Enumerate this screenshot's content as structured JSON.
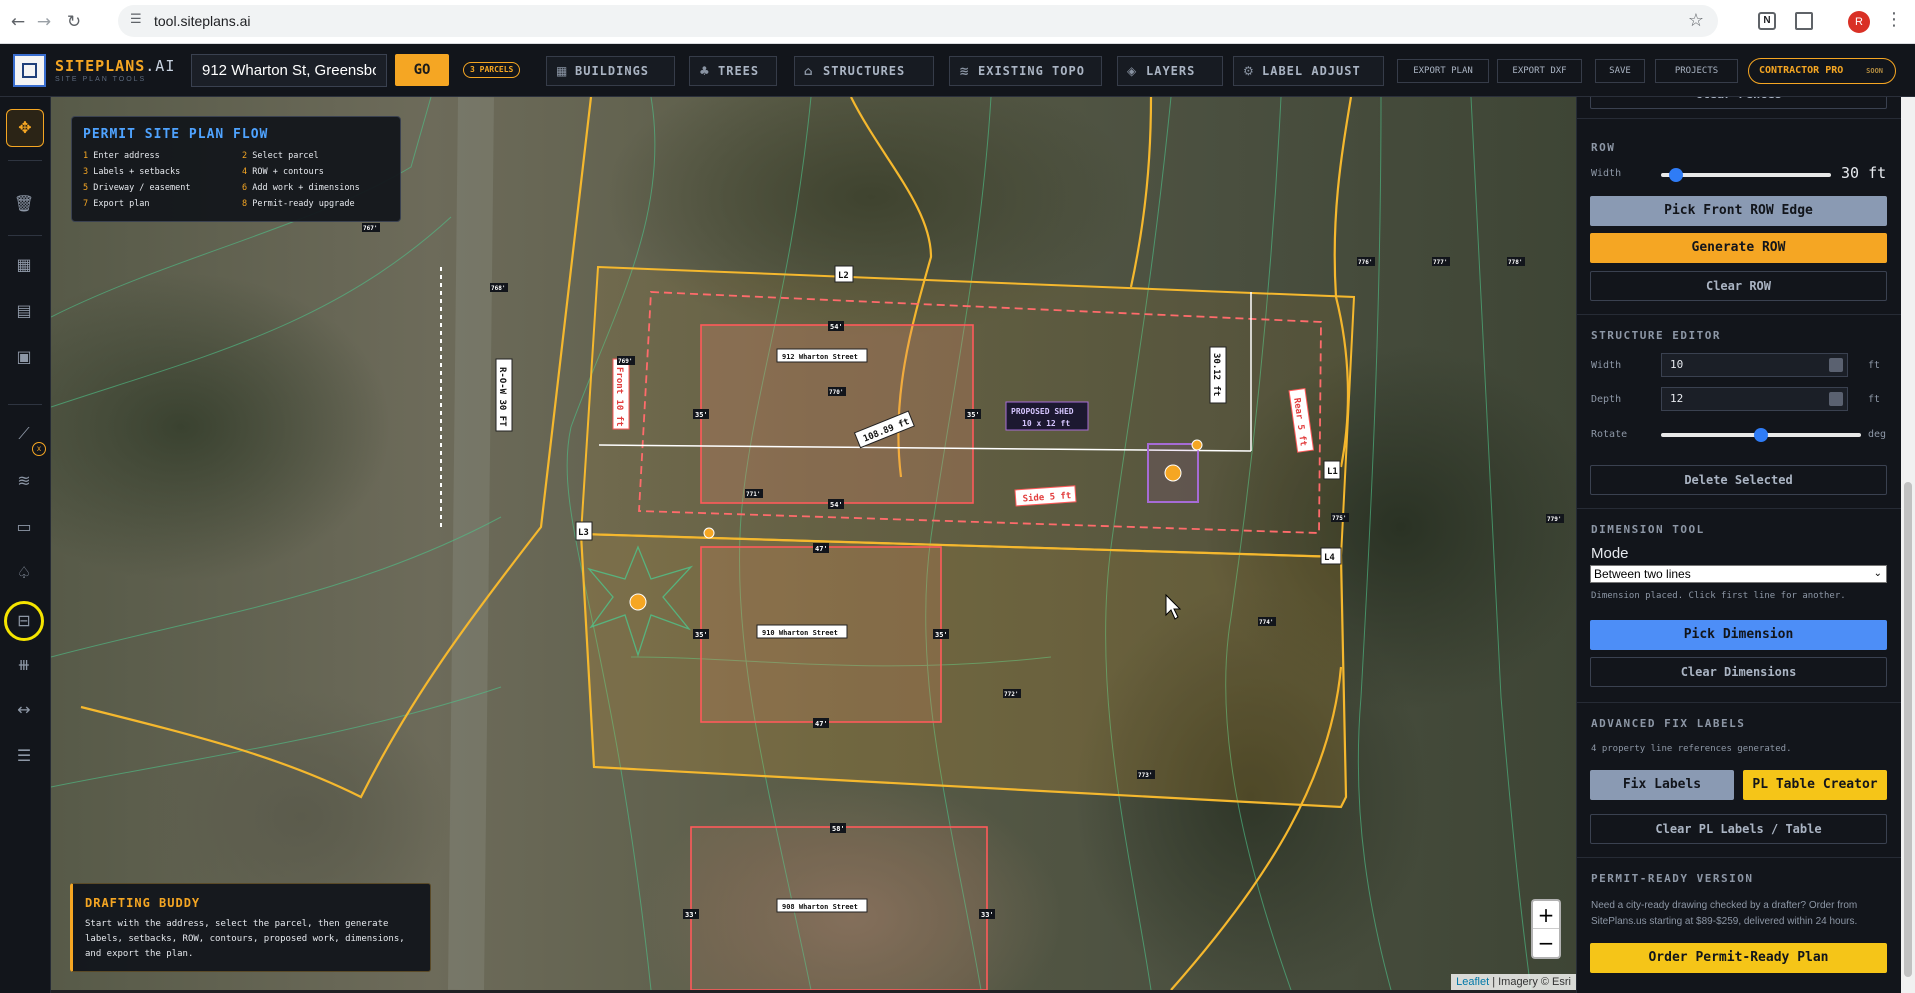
{
  "browser": {
    "url": "tool.siteplans.ai",
    "profile_initial": "R",
    "icons": [
      "back-icon",
      "forward-icon",
      "reload-icon",
      "site-info-icon",
      "bookmark-star-icon",
      "extensions-icon",
      "menu-icon"
    ]
  },
  "header": {
    "brand": "SITEPLANS",
    "brand_suffix": ".AI",
    "tagline": "SITE PLAN TOOLS",
    "address_value": "912 Wharton St, Greensbor",
    "go_label": "GO",
    "parcels_badge": "3 PARCELS",
    "buttons": [
      {
        "label": "BUILDINGS",
        "icon": "grid-icon"
      },
      {
        "label": "TREES",
        "icon": "tree-icon"
      },
      {
        "label": "STRUCTURES",
        "icon": "house-icon"
      },
      {
        "label": "EXISTING TOPO",
        "icon": "topo-icon"
      },
      {
        "label": "LAYERS",
        "icon": "layers-icon"
      },
      {
        "label": "LABEL ADJUST",
        "icon": "gear-icon"
      }
    ],
    "small_buttons": [
      "EXPORT PLAN",
      "EXPORT DXF",
      "SAVE",
      "PROJECTS"
    ],
    "pro_label": "CONTRACTOR PRO",
    "pro_soon": "SOON"
  },
  "toolbar": {
    "tools": [
      "select-tool-icon",
      "trash-icon",
      "grid-icon",
      "list-icon",
      "map-icon",
      "contour-icon",
      "contour-lines-icon",
      "road-icon",
      "tree-icon",
      "dimension-icon",
      "ruler-icon",
      "width-icon",
      "menu-lines-icon"
    ],
    "badge": "x"
  },
  "flow": {
    "title": "PERMIT SITE PLAN FLOW",
    "steps": [
      {
        "n": "1",
        "text": "Enter address"
      },
      {
        "n": "2",
        "text": "Select parcel"
      },
      {
        "n": "3",
        "text": "Labels + setbacks"
      },
      {
        "n": "4",
        "text": "ROW + contours"
      },
      {
        "n": "5",
        "text": "Driveway / easement"
      },
      {
        "n": "6",
        "text": "Add work + dimensions"
      },
      {
        "n": "7",
        "text": "Export plan"
      },
      {
        "n": "8",
        "text": "Permit-ready upgrade"
      }
    ]
  },
  "buddy": {
    "title": "DRAFTING BUDDY",
    "text": "Start with the address, select the parcel, then generate labels, setbacks, ROW, contours, proposed work, dimensions, and export the plan."
  },
  "map": {
    "row_label": "R-O-W 30 FT",
    "front_label": "Front 10 ft",
    "rear_label": "Rear 5 ft",
    "side_label": "Side 5 ft",
    "dim_label": "108.89 ft",
    "dim2_label": "30.12 ft",
    "shed_line1": "PROPOSED SHED",
    "shed_line2": "10 x 12 ft",
    "pl_labels": [
      "L1",
      "L2",
      "L3",
      "L4"
    ],
    "houses": [
      {
        "name": "912 Wharton Street",
        "front": "54'",
        "back": "54'",
        "left": "35'",
        "right": "35'"
      },
      {
        "name": "910 Wharton Street",
        "front": "47'",
        "back": "47'",
        "left": "35'",
        "right": "35'"
      },
      {
        "name": "908 Wharton Street",
        "front": "58'",
        "left": "33'",
        "right": "33'"
      }
    ],
    "contours": [
      "767'",
      "768'",
      "769'",
      "770'",
      "771'",
      "772'",
      "773'",
      "774'",
      "775'",
      "776'",
      "777'",
      "778'",
      "779'"
    ],
    "zoom_in": "+",
    "zoom_out": "−",
    "attribution_leaflet": "Leaflet",
    "attribution_rest": "| Imagery © Esri"
  },
  "panel": {
    "clear_fences": "Clear Fences",
    "row": {
      "title": "ROW",
      "width_label": "Width",
      "width_value": "30 ft",
      "width_fraction": 0.05,
      "pick_front": "Pick Front ROW Edge",
      "generate": "Generate ROW",
      "clear": "Clear ROW"
    },
    "structure": {
      "title": "STRUCTURE EDITOR",
      "width_label": "Width",
      "width_value": "10",
      "depth_label": "Depth",
      "depth_value": "12",
      "unit": "ft",
      "rotate_label": "Rotate",
      "rotate_unit": "deg",
      "rotate_fraction": 0.5,
      "delete": "Delete Selected"
    },
    "dimension": {
      "title": "DIMENSION TOOL",
      "mode_label": "Mode",
      "mode_value": "Between two lines",
      "note": "Dimension placed. Click first line for another.",
      "pick": "Pick Dimension",
      "clear": "Clear Dimensions"
    },
    "fix": {
      "title": "ADVANCED FIX LABELS",
      "note": "4 property line references generated.",
      "fix_labels": "Fix Labels",
      "pl_table": "PL Table Creator",
      "clear": "Clear PL Labels / Table"
    },
    "permit": {
      "title": "PERMIT-READY VERSION",
      "text": "Need a city-ready drawing checked by a drafter? Order from SitePlans.us starting at $89-$259, delivered within 24 hours.",
      "order": "Order Permit-Ready Plan"
    }
  },
  "colors": {
    "accent": "#f5a623",
    "blue": "#4d8ef7",
    "panel_bg": "#12151b",
    "setback": "#ff6b6b",
    "parcel": "#f5b82e"
  }
}
